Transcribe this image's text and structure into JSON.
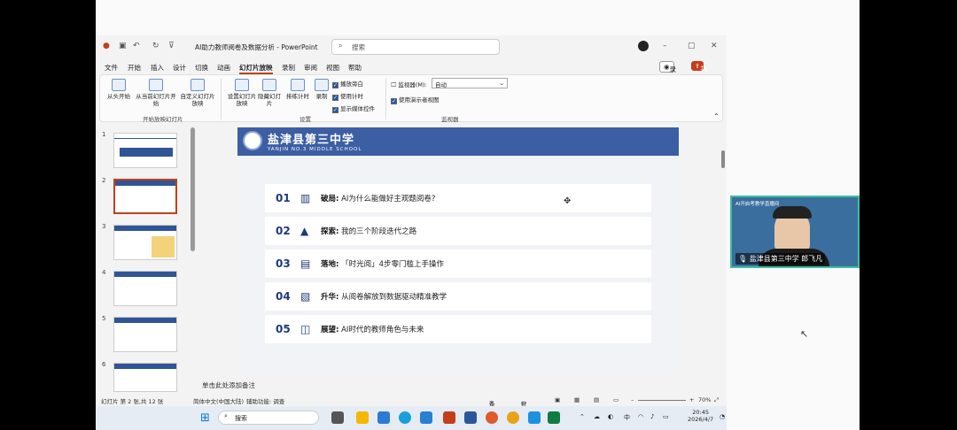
{
  "window": {
    "title": "AI助力教师阅卷及数据分析 - PowerPoint",
    "search_placeholder": "搜索",
    "record_label": "录制",
    "share_label": "共享"
  },
  "menu": [
    "文件",
    "开始",
    "插入",
    "设计",
    "切换",
    "动画",
    "幻灯片放映",
    "录制",
    "审阅",
    "视图",
    "帮助"
  ],
  "ribbon": {
    "btn_from_start": "从头开始",
    "btn_from_current": "从当前幻灯片开始",
    "btn_custom": "自定义幻灯片放映",
    "group_start": "开始放映幻灯片",
    "btn_setup": "设置幻灯片放映",
    "btn_hide": "隐藏幻灯片",
    "btn_rehearse": "排练计时",
    "btn_record": "录制",
    "chk_narration": "播放旁白",
    "chk_timing": "使用计时",
    "chk_media": "显示媒体控件",
    "group_setup": "设置",
    "monitor_label": "监视器(M):",
    "monitor_value": "自动",
    "chk_presenter": "使用演示者视图",
    "group_monitor": "监视器"
  },
  "thumbnails": [
    "1",
    "2",
    "3",
    "4",
    "5",
    "6"
  ],
  "slide": {
    "school_name": "盐津县第三中学",
    "school_en": "YANJIN NO.3 MIDDLE SCHOOL",
    "rows": [
      {
        "num": "01",
        "head": "破局:",
        "text": "AI为什么能做好主观题阅卷?"
      },
      {
        "num": "02",
        "head": "探索:",
        "text": "我的三个阶段迭代之路"
      },
      {
        "num": "03",
        "head": "落地:",
        "text": "「时光阅」4步零门槛上手操作"
      },
      {
        "num": "04",
        "head": "升华:",
        "text": "从阅卷解放到数据驱动精准教学"
      },
      {
        "num": "05",
        "head": "展望:",
        "text": "AI时代的教师角色与未来"
      }
    ]
  },
  "notes_placeholder": "单击此处添加备注",
  "status": {
    "slide_count": "幻灯片 第 2 张,共 12 张",
    "language": "简体中文(中国大陆)",
    "accessibility": "辅助功能: 调查",
    "notes": "备注",
    "comments": "批注",
    "zoom": "70%"
  },
  "taskbar": {
    "search": "搜索",
    "ime": "中",
    "time": "20:45",
    "date": "2026/4/7"
  },
  "video": {
    "caption": "AI开启考教学直播间",
    "speaker": "盐津县第三中学 郎飞凡"
  }
}
